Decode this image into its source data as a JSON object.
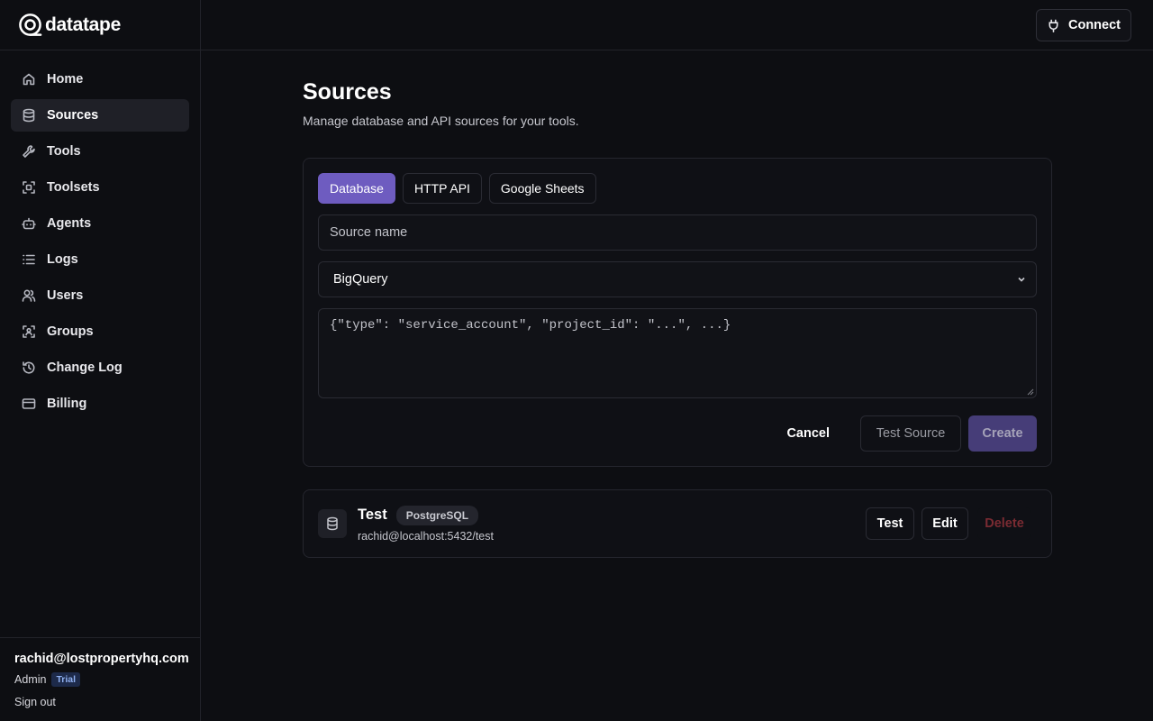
{
  "brand": {
    "name": "datatape"
  },
  "sidebar": {
    "items": [
      {
        "label": "Home",
        "icon": "home-icon"
      },
      {
        "label": "Sources",
        "icon": "database-icon",
        "active": true
      },
      {
        "label": "Tools",
        "icon": "wrench-icon"
      },
      {
        "label": "Toolsets",
        "icon": "toolset-icon"
      },
      {
        "label": "Agents",
        "icon": "bot-icon"
      },
      {
        "label": "Logs",
        "icon": "list-icon"
      },
      {
        "label": "Users",
        "icon": "users-icon"
      },
      {
        "label": "Groups",
        "icon": "group-icon"
      },
      {
        "label": "Change Log",
        "icon": "history-icon"
      },
      {
        "label": "Billing",
        "icon": "credit-card-icon"
      }
    ],
    "footer": {
      "email": "rachid@lostpropertyhq.com",
      "role": "Admin",
      "plan_badge": "Trial",
      "sign_out": "Sign out"
    }
  },
  "topbar": {
    "connect_label": "Connect"
  },
  "page": {
    "title": "Sources",
    "subtitle": "Manage database and API sources for your tools."
  },
  "form": {
    "tabs": [
      "Database",
      "HTTP API",
      "Google Sheets"
    ],
    "active_tab": "Database",
    "source_name_placeholder": "Source name",
    "source_name_value": "",
    "db_type_selected": "BigQuery",
    "credentials_placeholder": "{\"type\": \"service_account\", \"project_id\": \"...\", ...}",
    "cancel_label": "Cancel",
    "test_source_label": "Test Source",
    "create_label": "Create"
  },
  "sources": [
    {
      "name": "Test",
      "type": "PostgreSQL",
      "connection": "rachid@localhost:5432/test",
      "test_label": "Test",
      "edit_label": "Edit",
      "delete_label": "Delete"
    }
  ],
  "colors": {
    "accent": "#6e5cc0",
    "background": "#0d0e12",
    "danger": "#7a2b32"
  }
}
